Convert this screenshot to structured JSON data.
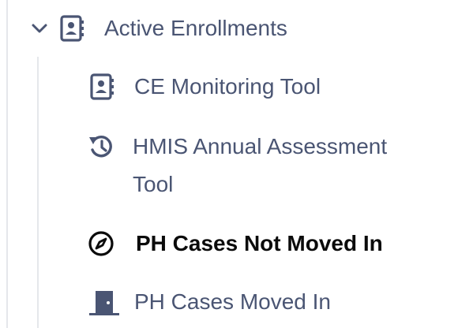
{
  "tree": {
    "parent": {
      "label": "Active Enrollments",
      "icon": "contact-book-icon",
      "expanded": true
    },
    "children": [
      {
        "label": "CE Monitoring Tool",
        "icon": "contact-book-icon",
        "active": false
      },
      {
        "label": "HMIS Annual Assessment Tool",
        "icon": "history-icon",
        "active": false
      },
      {
        "label": "PH Cases Not Moved In",
        "icon": "compass-icon",
        "active": true
      },
      {
        "label": "PH Cases Moved In",
        "icon": "door-icon",
        "active": false
      }
    ]
  },
  "colors": {
    "text": "#4a5573",
    "active_text": "#0b0b0b",
    "rail": "#e5e7eb"
  }
}
